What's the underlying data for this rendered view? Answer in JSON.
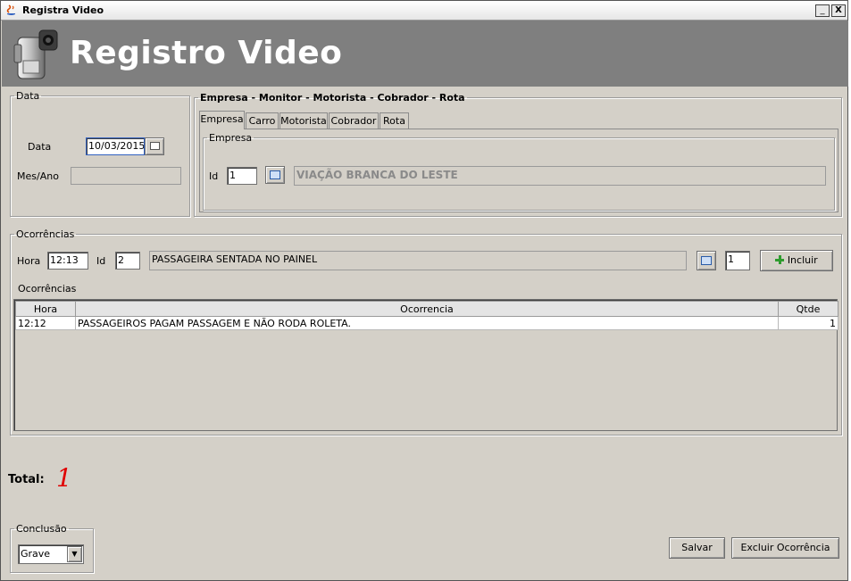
{
  "window": {
    "title": "Registra Video",
    "minimize_label": "_",
    "close_label": "X"
  },
  "banner": {
    "title": "Registro Video"
  },
  "data_panel": {
    "legend": "Data",
    "date_label": "Data",
    "date_value": "10/03/2015",
    "mes_ano_label": "Mes/Ano",
    "mes_ano_value": ""
  },
  "empresa_panel": {
    "legend": "Empresa - Monitor - Motorista - Cobrador - Rota",
    "tabs": [
      {
        "label": "Empresa",
        "active": true
      },
      {
        "label": "Carro"
      },
      {
        "label": "Motorista"
      },
      {
        "label": "Cobrador"
      },
      {
        "label": "Rota"
      }
    ],
    "inner_legend": "Empresa",
    "id_label": "Id",
    "id_value": "1",
    "name_value": "VIAÇÃO BRANCA DO LESTE"
  },
  "ocorrencias_panel": {
    "legend": "Ocorrências",
    "hora_label": "Hora",
    "hora_value": "12:13",
    "id_label": "Id",
    "id_value": "2",
    "description_value": "PASSAGEIRA SENTADA NO PAINEL",
    "qty_value": "1",
    "incluir_label": "Incluir",
    "list_label": "Ocorrências",
    "table": {
      "headers": [
        "Hora",
        "Ocorrencia",
        "Qtde"
      ],
      "rows": [
        [
          "12:12",
          "PASSAGEIROS PAGAM PASSAGEM E NÃO RODA ROLETA.",
          "1"
        ]
      ]
    }
  },
  "total": {
    "label": "Total:",
    "value": "1",
    "value_color": "#e00000"
  },
  "conclusao": {
    "legend": "Conclusão",
    "selected": "Grave"
  },
  "actions": {
    "salvar_label": "Salvar",
    "excluir_label": "Excluir Ocorrência"
  }
}
